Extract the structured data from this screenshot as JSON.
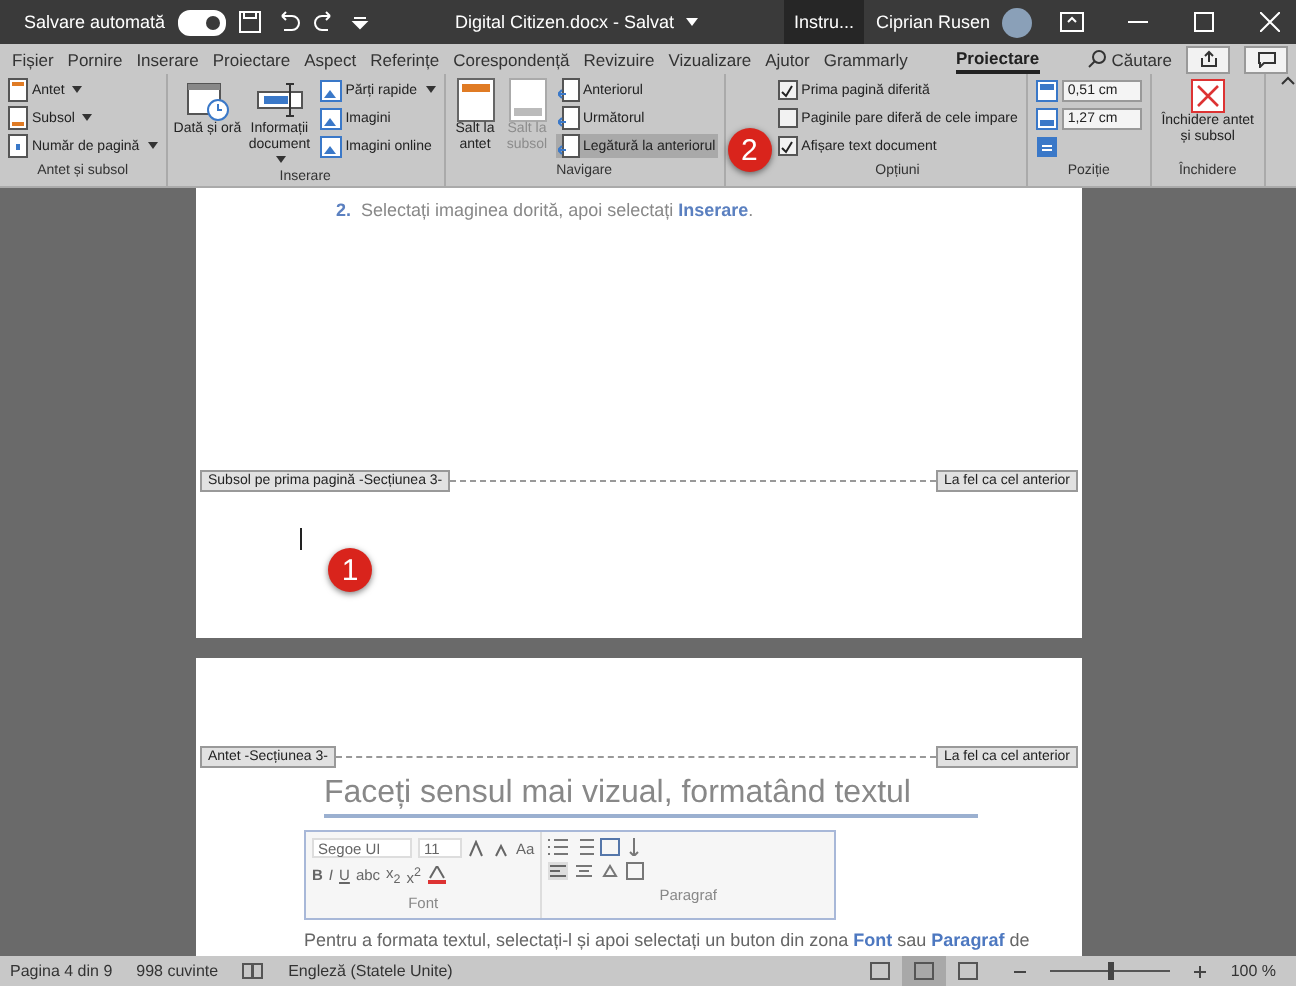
{
  "title_bar": {
    "autosave_label": "Salvare automată",
    "autosave_on": true,
    "document_title": "Digital Citizen.docx - Salvat",
    "context_tab": "Instru...",
    "user_name": "Ciprian Rusen"
  },
  "menu_tabs": [
    {
      "label": "Fișier",
      "selected": false
    },
    {
      "label": "Pornire",
      "selected": false
    },
    {
      "label": "Inserare",
      "selected": false
    },
    {
      "label": "Proiectare",
      "selected": false
    },
    {
      "label": "Aspect",
      "selected": false
    },
    {
      "label": "Referințe",
      "selected": false
    },
    {
      "label": "Corespondență",
      "selected": false
    },
    {
      "label": "Revizuire",
      "selected": false
    },
    {
      "label": "Vizualizare",
      "selected": false
    },
    {
      "label": "Ajutor",
      "selected": false
    },
    {
      "label": "Grammarly",
      "selected": false
    },
    {
      "label": "Proiectare",
      "selected": true
    }
  ],
  "search": {
    "label": "Căutare"
  },
  "ribbon": {
    "callout": "2",
    "groups": [
      {
        "title": "Antet și subsol",
        "items": [
          {
            "kind": "small",
            "label": "Antet",
            "dropdown": true
          },
          {
            "kind": "small",
            "label": "Subsol",
            "dropdown": true
          },
          {
            "kind": "small",
            "label": "Număr de pagină",
            "dropdown": true
          }
        ]
      },
      {
        "title": "Inserare",
        "items": [
          {
            "kind": "large",
            "label": "Dată și oră"
          },
          {
            "kind": "large",
            "label": "Informații document",
            "dropdown": true
          },
          {
            "kind": "small",
            "label": "Părți rapide",
            "dropdown": true
          },
          {
            "kind": "small",
            "label": "Imagini"
          },
          {
            "kind": "small",
            "label": "Imagini online"
          }
        ]
      },
      {
        "title": "Navigare",
        "items": [
          {
            "kind": "large",
            "label": "Salt la antet"
          },
          {
            "kind": "large",
            "label": "Salt la subsol",
            "disabled": true
          },
          {
            "kind": "small",
            "label": "Anteriorul"
          },
          {
            "kind": "small",
            "label": "Următorul"
          },
          {
            "kind": "small",
            "label": "Legătură la anteriorul",
            "on": true
          }
        ]
      },
      {
        "title": "Opțiuni",
        "items": [
          {
            "kind": "checkbox",
            "label": "Prima pagină diferită",
            "checked": true
          },
          {
            "kind": "checkbox",
            "label": "Paginile pare diferă de cele impare",
            "checked": false
          },
          {
            "kind": "checkbox",
            "label": "Afișare text document",
            "checked": true
          }
        ]
      },
      {
        "title": "Poziție",
        "items": [
          {
            "kind": "spin",
            "value": "0,51 cm"
          },
          {
            "kind": "spin",
            "value": "1,27 cm"
          },
          {
            "kind": "tool"
          }
        ]
      },
      {
        "title": "Închidere",
        "items": [
          {
            "kind": "close",
            "label": "Închidere antet și subsol"
          }
        ]
      }
    ]
  },
  "page_1": {
    "instruction_number": "2.",
    "instruction": "Selectați imaginea dorită, apoi selectați **Inserare**.",
    "footer_tag": "Subsol pe prima pagină -Secțiunea 3-",
    "link_tag": "La fel ca cel anterior",
    "callout": "1"
  },
  "page_2": {
    "header_tag": "Antet -Secțiunea 3-",
    "link_tag": "La fel ca cel anterior",
    "heading": "Faceți sensul mai vizual, formatând textul",
    "ribbon_picture": {
      "font_name": "Segoe UI",
      "font_size": "11",
      "case_button": "Aa",
      "format_buttons": [
        "B",
        "I",
        "U",
        "abc",
        "x$_{2}$",
        "x$^{2}$"
      ],
      "groups": [
        "Font",
        "Paragraf"
      ]
    },
    "paragraph": "Pentru a formata textul, selectați-l și apoi selectați un buton din zona **Font** sau **Paragraf** de"
  },
  "status_bar": {
    "page": "Pagina 4 din 9",
    "words": "998 cuvinte",
    "language": "Engleză (Statele Unite)",
    "views": [
      {
        "selected": false
      },
      {
        "selected": true
      },
      {
        "selected": false
      }
    ],
    "zoom_slider": {
      "level": 0.5
    },
    "zoom": "100 %"
  }
}
